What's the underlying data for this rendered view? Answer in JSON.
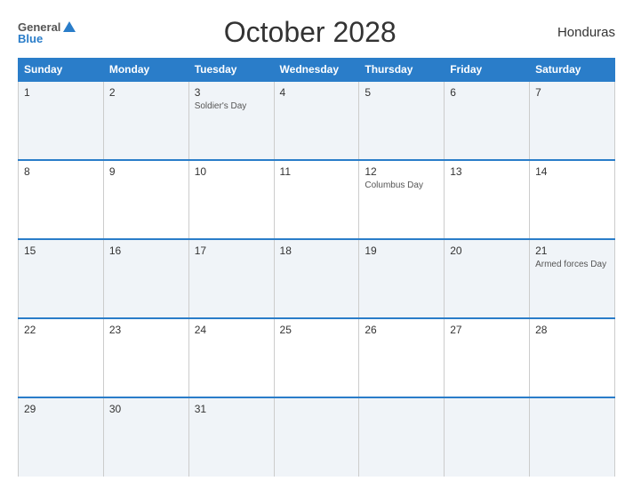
{
  "header": {
    "logo_general": "General",
    "logo_blue": "Blue",
    "title": "October 2028",
    "country": "Honduras"
  },
  "calendar": {
    "days_of_week": [
      "Sunday",
      "Monday",
      "Tuesday",
      "Wednesday",
      "Thursday",
      "Friday",
      "Saturday"
    ],
    "weeks": [
      [
        {
          "day": "1",
          "holiday": ""
        },
        {
          "day": "2",
          "holiday": ""
        },
        {
          "day": "3",
          "holiday": "Soldier's Day"
        },
        {
          "day": "4",
          "holiday": ""
        },
        {
          "day": "5",
          "holiday": ""
        },
        {
          "day": "6",
          "holiday": ""
        },
        {
          "day": "7",
          "holiday": ""
        }
      ],
      [
        {
          "day": "8",
          "holiday": ""
        },
        {
          "day": "9",
          "holiday": ""
        },
        {
          "day": "10",
          "holiday": ""
        },
        {
          "day": "11",
          "holiday": ""
        },
        {
          "day": "12",
          "holiday": "Columbus Day"
        },
        {
          "day": "13",
          "holiday": ""
        },
        {
          "day": "14",
          "holiday": ""
        }
      ],
      [
        {
          "day": "15",
          "holiday": ""
        },
        {
          "day": "16",
          "holiday": ""
        },
        {
          "day": "17",
          "holiday": ""
        },
        {
          "day": "18",
          "holiday": ""
        },
        {
          "day": "19",
          "holiday": ""
        },
        {
          "day": "20",
          "holiday": ""
        },
        {
          "day": "21",
          "holiday": "Armed forces Day"
        }
      ],
      [
        {
          "day": "22",
          "holiday": ""
        },
        {
          "day": "23",
          "holiday": ""
        },
        {
          "day": "24",
          "holiday": ""
        },
        {
          "day": "25",
          "holiday": ""
        },
        {
          "day": "26",
          "holiday": ""
        },
        {
          "day": "27",
          "holiday": ""
        },
        {
          "day": "28",
          "holiday": ""
        }
      ],
      [
        {
          "day": "29",
          "holiday": ""
        },
        {
          "day": "30",
          "holiday": ""
        },
        {
          "day": "31",
          "holiday": ""
        },
        {
          "day": "",
          "holiday": ""
        },
        {
          "day": "",
          "holiday": ""
        },
        {
          "day": "",
          "holiday": ""
        },
        {
          "day": "",
          "holiday": ""
        }
      ]
    ]
  }
}
